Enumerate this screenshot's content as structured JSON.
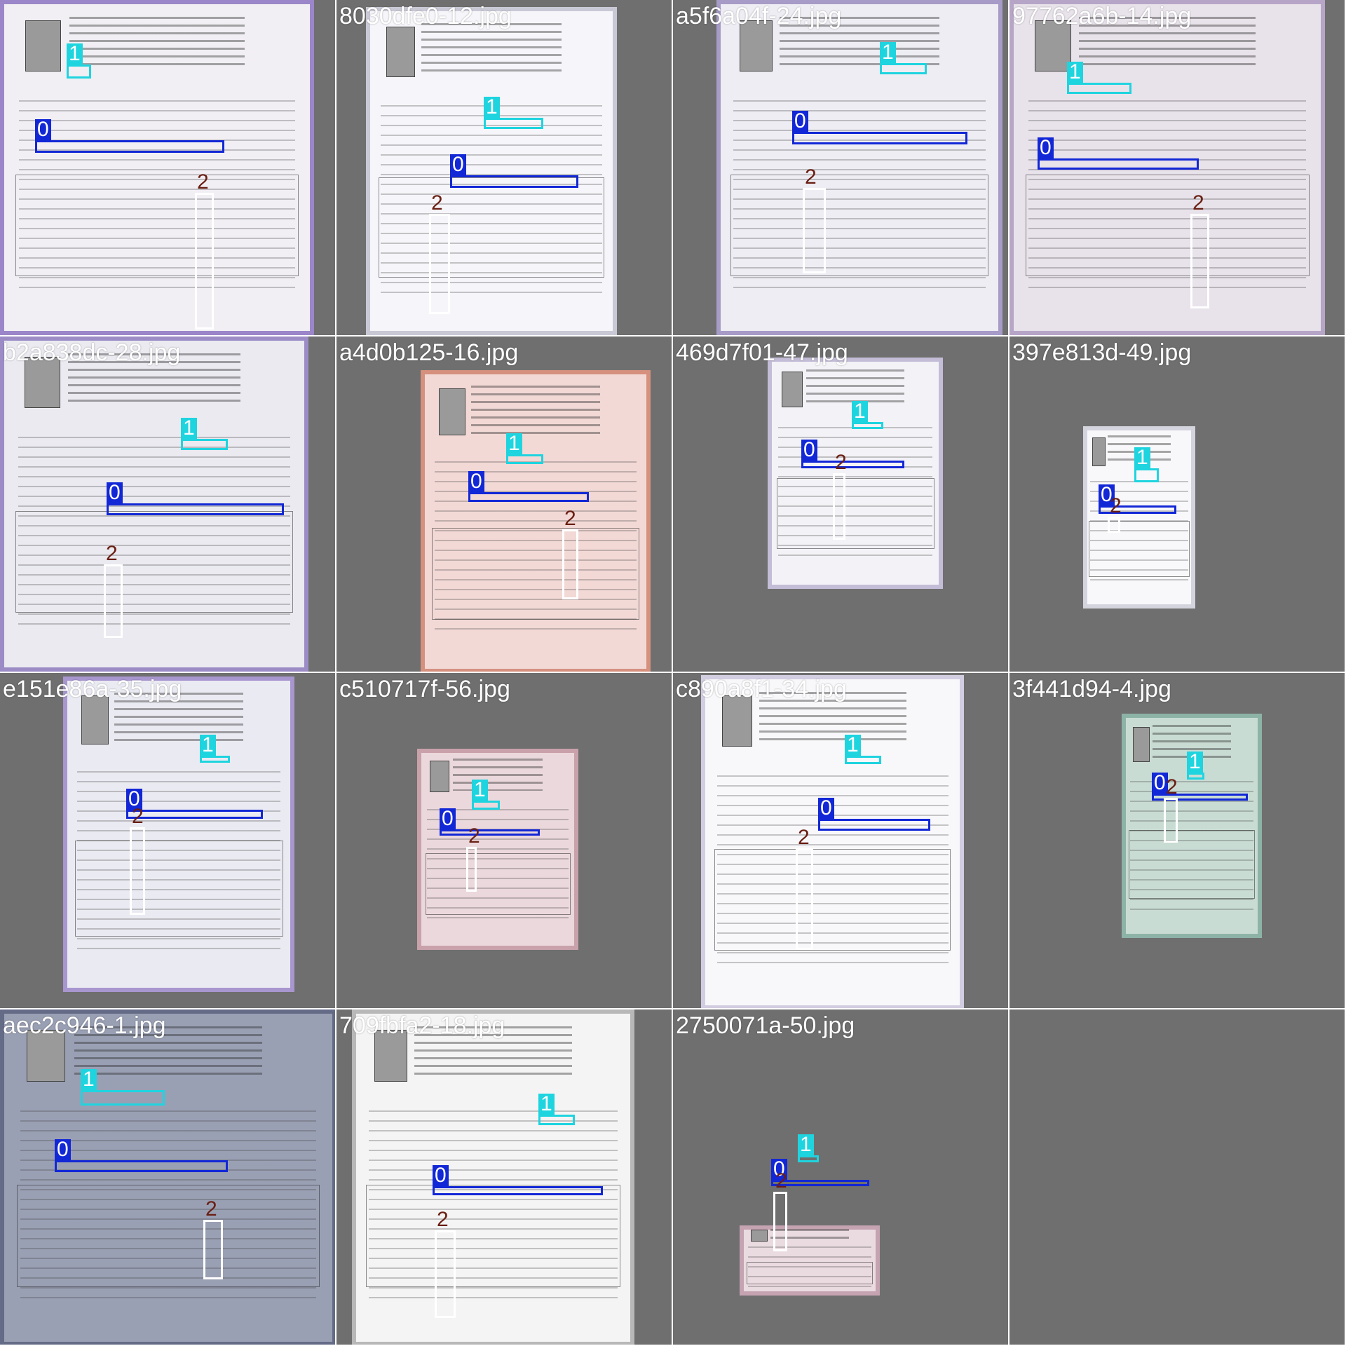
{
  "tiles": [
    {
      "filename": "",
      "labels": [
        "0",
        "1",
        "2"
      ],
      "colors": {
        "bg": "#6f6f6f",
        "paper": "#f1eff4",
        "frame": "#9b86c9"
      }
    },
    {
      "filename": "8030dfe0-12.jpg",
      "labels": [
        "0",
        "1",
        "2"
      ],
      "colors": {
        "bg": "#6f6f6f",
        "paper": "#f6f6fa",
        "frame": "#c9c9d6"
      }
    },
    {
      "filename": "a5f6a04f-24.jpg",
      "labels": [
        "0",
        "1",
        "2"
      ],
      "colors": {
        "bg": "#6f6f6f",
        "paper": "#eeedf3",
        "frame": "#a79bc8"
      }
    },
    {
      "filename": "97762a6b-14.jpg",
      "labels": [
        "0",
        "1",
        "2"
      ],
      "colors": {
        "bg": "#6f6f6f",
        "paper": "#e8e2ea",
        "frame": "#b7a5c8"
      }
    },
    {
      "filename": "b2a838dc-28.jpg",
      "labels": [
        "0",
        "1",
        "2"
      ],
      "colors": {
        "bg": "#6f6f6f",
        "paper": "#eaeaf0",
        "frame": "#9c8cc6"
      }
    },
    {
      "filename": "a4d0b125-16.jpg",
      "labels": [
        "0",
        "1",
        "2"
      ],
      "colors": {
        "bg": "#6f6f6f",
        "paper": "#f2d9d6",
        "frame": "#d6907e"
      }
    },
    {
      "filename": "469d7f01-47.jpg",
      "labels": [
        "0",
        "1",
        "2"
      ],
      "colors": {
        "bg": "#6f6f6f",
        "paper": "#f3f2f6",
        "frame": "#c4bdd7"
      }
    },
    {
      "filename": "397e813d-49.jpg",
      "labels": [
        "0",
        "1",
        "2"
      ],
      "colors": {
        "bg": "#6f6f6f",
        "paper": "#f8f8fb",
        "frame": "#d4d4de"
      }
    },
    {
      "filename": "e151e86a-35.jpg",
      "labels": [
        "0",
        "1",
        "2"
      ],
      "colors": {
        "bg": "#6f6f6f",
        "paper": "#eaeaf2",
        "frame": "#a896cf"
      }
    },
    {
      "filename": "c510717f-56.jpg",
      "labels": [
        "0",
        "1",
        "2"
      ],
      "colors": {
        "bg": "#6f6f6f",
        "paper": "#ebd8dc",
        "frame": "#c9a1ab"
      }
    },
    {
      "filename": "c890a8f1-34.jpg",
      "labels": [
        "0",
        "1",
        "2"
      ],
      "colors": {
        "bg": "#6f6f6f",
        "paper": "#f8f8fb",
        "frame": "#d2cde0"
      }
    },
    {
      "filename": "3f441d94-4.jpg",
      "labels": [
        "0",
        "1",
        "2"
      ],
      "colors": {
        "bg": "#6f6f6f",
        "paper": "#c9dcd4",
        "frame": "#8db3a7"
      }
    },
    {
      "filename": "aec2c946-1.jpg",
      "labels": [
        "0",
        "1",
        "2"
      ],
      "colors": {
        "bg": "#6f6f6f",
        "paper": "#9aa0b4",
        "frame": "#646b86"
      }
    },
    {
      "filename": "709fbfa2-18.jpg",
      "labels": [
        "0",
        "1",
        "2"
      ],
      "colors": {
        "bg": "#6f6f6f",
        "paper": "#f4f4f4",
        "frame": "#b8b8b8"
      }
    },
    {
      "filename": "2750071a-50.jpg",
      "labels": [
        "0",
        "1",
        "2"
      ],
      "colors": {
        "bg": "#6f6f6f",
        "paper": "#eadbe0",
        "frame": "#c5a3b1"
      }
    },
    {
      "filename": "",
      "labels": [],
      "colors": {
        "bg": "#6f6f6f",
        "paper": "#6f6f6f",
        "frame": "#6f6f6f"
      }
    }
  ]
}
